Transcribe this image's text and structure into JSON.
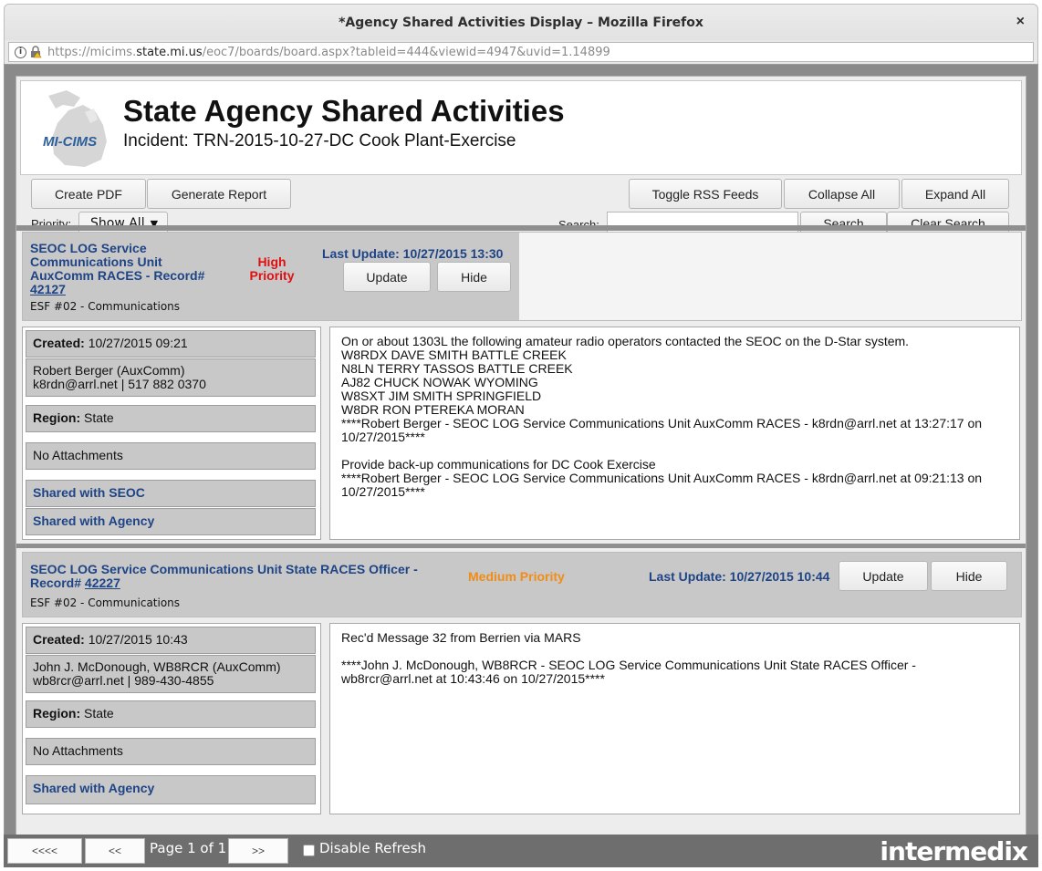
{
  "window": {
    "title": "*Agency Shared Activities Display – Mozilla Firefox",
    "close": "×",
    "url_prefix": "https://micims.",
    "url_domain": "state.mi.us",
    "url_path": "/eoc7/boards/board.aspx?tableid=444&viewid=4947&uvid=1.14899"
  },
  "header": {
    "logo_text": "MI-CIMS",
    "title": "State Agency Shared Activities",
    "subtitle": "Incident: TRN-2015-10-27-DC Cook Plant-Exercise"
  },
  "toolbar": {
    "create_pdf": "Create PDF",
    "generate_report": "Generate Report",
    "toggle_rss": "Toggle RSS Feeds",
    "collapse_all": "Collapse All",
    "expand_all": "Expand All",
    "priority_label": "Priority:",
    "priority_value": "Show All",
    "search_label": "Search:",
    "search_value": "",
    "search_button": "Search",
    "clear_search": "Clear Search"
  },
  "records": [
    {
      "title": "SEOC LOG Service Communications Unit AuxComm RACES - Record#",
      "record_no": "42127",
      "esf": "ESF #02 - Communications",
      "priority": "High Priority",
      "last_update": "Last Update: 10/27/2015 13:30",
      "update_btn": "Update",
      "hide_btn": "Hide",
      "created_label": "Created:",
      "created_value": "10/27/2015 09:21",
      "contact_line1": "Robert Berger  (AuxComm)",
      "contact_line2": "k8rdn@arrl.net | 517 882 0370",
      "region_label": "Region:",
      "region_value": "State",
      "attachments": "No Attachments",
      "shared_1": "Shared with SEOC",
      "shared_2": "Shared with Agency",
      "body": "On or about 1303L the following amateur radio operators contacted the SEOC on the D-Star system.\nW8RDX DAVE SMITH BATTLE CREEK\nN8LN TERRY TASSOS BATTLE CREEK\nAJ82 CHUCK NOWAK WYOMING\nW8SXT JIM SMITH SPRINGFIELD\nW8DR RON PTEREKA MORAN\n****Robert Berger - SEOC LOG Service Communications Unit AuxComm RACES - k8rdn@arrl.net at 13:27:17 on\n10/27/2015****\n\nProvide back-up communications for DC Cook Exercise\n****Robert Berger - SEOC LOG Service Communications Unit AuxComm RACES - k8rdn@arrl.net at 09:21:13 on\n10/27/2015****"
    },
    {
      "title": "SEOC LOG Service Communications Unit State RACES Officer -",
      "record_prefix": "Record#",
      "record_no": "42227",
      "esf": "ESF #02 - Communications",
      "priority": "Medium Priority",
      "last_update": "Last Update: 10/27/2015 10:44",
      "update_btn": "Update",
      "hide_btn": "Hide",
      "created_label": "Created:",
      "created_value": "10/27/2015 10:43",
      "contact_line1": "John J. McDonough, WB8RCR  (AuxComm)",
      "contact_line2": "wb8rcr@arrl.net | 989-430-4855",
      "region_label": "Region:",
      "region_value": "State",
      "attachments": "No Attachments",
      "shared_1": "Shared with Agency",
      "body": "Rec'd Message 32 from Berrien via MARS\n\n****John J. McDonough, WB8RCR - SEOC LOG Service Communications Unit State RACES Officer -\nwb8rcr@arrl.net at 10:43:46 on 10/27/2015****"
    }
  ],
  "footer": {
    "first": "<<<<",
    "prev": "<<",
    "page_text": "Page 1 of 1",
    "next": ">>",
    "disable_refresh": "Disable Refresh",
    "brand": "intermedix"
  }
}
